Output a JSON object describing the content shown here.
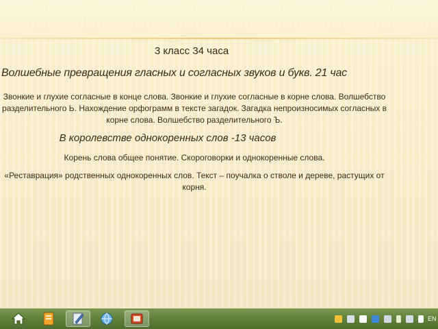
{
  "slide": {
    "title": "3 класс 34 часа",
    "section1_heading": "Волшебные превращения гласных и согласных звуков и букв. 21 час",
    "section1_text": "Звонкие и глухие согласные в конце слова. Звонкие и глухие согласные в корне слова. Волшебство  разделительного Ь. Нахождение орфограмм в тексте загадок. Загадка непроизносимых согласных в корне слова. Волшебство разделительного Ъ.",
    "section2_heading": "В королевстве однокоренных слов -13 часов",
    "section2_text1": "Корень слова общее понятие. Скороговорки и однокоренные слова.",
    "section2_text2": "«Реставрация» родственных однокоренных слов. Текст – поучалка о стволе и дереве, растущих от корня."
  },
  "taskbar": {
    "buttons": [
      {
        "icon": "home-icon"
      },
      {
        "icon": "notebook-icon"
      },
      {
        "icon": "document-pen-icon"
      },
      {
        "icon": "globe-browser-icon"
      },
      {
        "icon": "powerpoint-icon"
      }
    ],
    "tray_icons": [
      "network-icon",
      "antivirus-icon",
      "flag-icon",
      "keyboard-icon",
      "update-icon",
      "battery-icon",
      "monitor-icon",
      "speaker-icon"
    ],
    "language": "EN"
  },
  "colors": {
    "text": "#3d2a12",
    "slide_bg": "#f7f0cf",
    "taskbar": "#66853f"
  }
}
